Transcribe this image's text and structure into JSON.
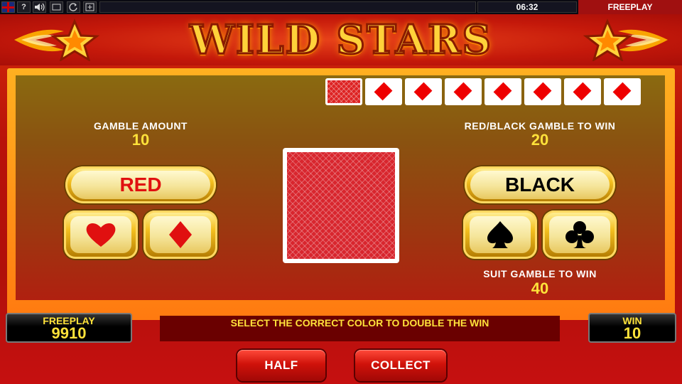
{
  "topbar": {
    "help_label": "?",
    "clock": "06:32",
    "mode": "FREEPLAY"
  },
  "header": {
    "title": "WILD STARS"
  },
  "history": {
    "cards": [
      "back",
      "diamond",
      "diamond",
      "diamond",
      "diamond",
      "diamond",
      "diamond",
      "diamond"
    ]
  },
  "gamble": {
    "amount_label": "GAMBLE AMOUNT",
    "amount_value": "10",
    "color_win_label": "RED/BLACK GAMBLE TO WIN",
    "color_win_value": "20",
    "suit_win_label": "SUIT GAMBLE TO WIN",
    "suit_win_value": "40",
    "red_label": "RED",
    "black_label": "BLACK"
  },
  "colors": {
    "red_text": "#e01010",
    "black_text": "#000000",
    "accent_yellow": "#ffe23a"
  },
  "footer": {
    "balance_label": "FREEPLAY",
    "balance_value": "9910",
    "win_label": "WIN",
    "win_value": "10",
    "message": "SELECT THE CORRECT COLOR TO DOUBLE THE WIN",
    "half_label": "HALF",
    "collect_label": "COLLECT"
  }
}
